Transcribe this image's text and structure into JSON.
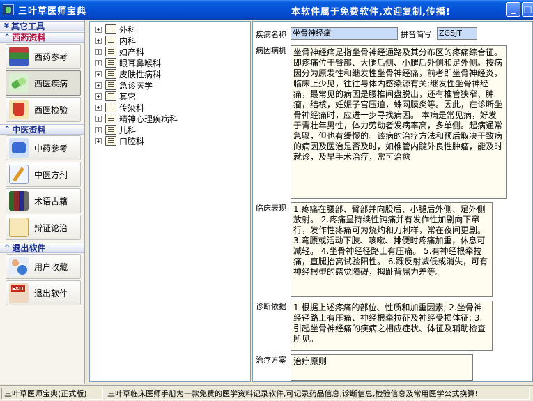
{
  "window": {
    "title": "三叶草医师宝典",
    "notice": "本软件属于免费软件,欢迎复制,传播!",
    "minimize_glyph": "_",
    "maximize_glyph": "□"
  },
  "sidebar": {
    "sections": [
      {
        "label": "其它工具",
        "color": "#1b2f8c"
      },
      {
        "label": "西药资料",
        "color": "#b0103a"
      },
      {
        "label": "中医资料",
        "color": "#1b2f8c"
      },
      {
        "label": "退出软件",
        "color": "#1b2f8c"
      }
    ],
    "items": [
      {
        "label": "西药参考",
        "icon": "books-icon"
      },
      {
        "label": "西医疾病",
        "icon": "pill-icon",
        "active": true
      },
      {
        "label": "西医检验",
        "icon": "lab-flask-icon"
      },
      {
        "label": "中药参考",
        "icon": "herb-drum-icon"
      },
      {
        "label": "中医方剂",
        "icon": "prescription-note-icon"
      },
      {
        "label": "术语古籍",
        "icon": "bookshelf-icon"
      },
      {
        "label": "辩证论治",
        "icon": "scroll-icon"
      },
      {
        "label": "用户收藏",
        "icon": "users-icon"
      },
      {
        "label": "退出软件",
        "icon": "exit-icon"
      }
    ]
  },
  "tree": {
    "items": [
      {
        "label": "外科",
        "expander": "+"
      },
      {
        "label": "内科",
        "expander": "+"
      },
      {
        "label": "妇产科",
        "expander": "+"
      },
      {
        "label": "眼耳鼻喉科",
        "expander": "+"
      },
      {
        "label": "皮肤性病科",
        "expander": "+"
      },
      {
        "label": "急诊医学",
        "expander": "+"
      },
      {
        "label": "其它",
        "expander": "+"
      },
      {
        "label": "传染科",
        "expander": "+"
      },
      {
        "label": "精神心理疾病科",
        "expander": "+"
      },
      {
        "label": "儿科",
        "expander": "+"
      },
      {
        "label": "口腔科",
        "expander": "+"
      }
    ]
  },
  "detail": {
    "disease_name_label": "疾病名称",
    "disease_name_value": "坐骨神经痛",
    "pinyin_label": "拼音简写",
    "pinyin_value": "ZGSJT",
    "etiology_label": "病因病机",
    "etiology_text": "坐骨神经痛是指坐骨神经通路及其分布区的疼痛综合征。即疼痛位于臀部、大腿后侧、小腿后外侧和足外侧。按病因分为原发性和继发性坐骨神经痛，前者即坐骨神经炎，临床上少见，往往与体内感染源有关;继发性坐骨神经痛，最常见的病因是腰椎间盘脱出，还有椎管狭窄、肿瘤，结核，妊娠子宫压迫，蛛网膜炎等。因此，在诊断坐骨神经痛时，应进一步寻找病因。  本病是常见病，好发于青壮年男性，体力劳动者发病率高，多单侧。起病通常急骤，但也有缓慢的。该病的治疗方法和预后取决于致病的病因及医治是否及时，如椎管内髓外良性肿瘤，能及时就诊，及早手术治疗，常可治愈",
    "clinical_label": "临床表现",
    "clinical_text": "1.疼痛在腰部、臀部并向股后、小腿后外侧、足外侧放射。  2.疼痛呈持续性钝痛并有发作性加剧向下窜行，发作性疼痛可为烧灼和刀刺样，常在夜间更剧。  3.弯腰或活动下肢、咳嗽、排便时疼痛加重，休息可减轻。  4.坐骨神经径路上有压痛。  5.有神经根牵拉痛，直腿抬高试验阳性。  6.踝反射减低或消失，可有神经根型的感觉障碍，拇趾背屈力差等。",
    "diagnosis_label": "诊断依据",
    "diagnosis_text": "1.根据上述疼痛的部位、性质和加重因素;  2.坐骨神经径路上有压痛、神经根牵拉征及神经受损体征;  3.引起坐骨神经痛的疾病之相应症状、体征及辅助检查所见。",
    "treatment_label": "治疗方案",
    "treatment_text": "治疗原则"
  },
  "statusbar": {
    "version": "三叶草医师宝典(正式版)",
    "message": "三叶草临床医师手册为一款免费的医学资料记录软件,可记录药品信息,诊断信息,检验信息及常用医学公式换算!"
  }
}
